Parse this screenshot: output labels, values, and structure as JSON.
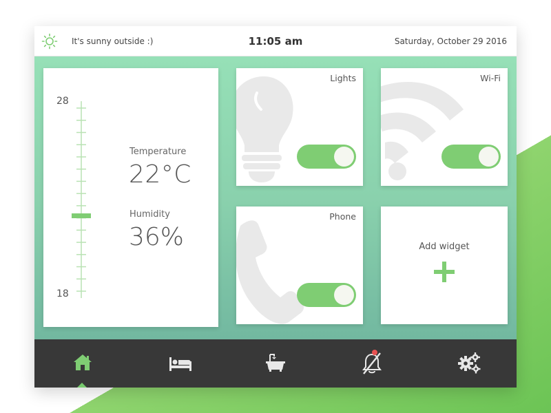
{
  "header": {
    "weather_icon": "sun-icon",
    "weather_text": "It's sunny outside :)",
    "time": "11:05 am",
    "date": "Saturday, October 29 2016"
  },
  "climate": {
    "scale_max": "28",
    "scale_min": "18",
    "slider_level": 0.5,
    "temperature_label": "Temperature",
    "temperature_value": "22°C",
    "humidity_label": "Humidity",
    "humidity_value": "36%"
  },
  "widgets": {
    "lights": {
      "label": "Lights",
      "icon": "lightbulb-icon",
      "on": true
    },
    "wifi": {
      "label": "Wi-Fi",
      "icon": "wifi-icon",
      "on": true
    },
    "phone": {
      "label": "Phone",
      "icon": "phone-icon",
      "on": true
    },
    "add": {
      "label": "Add widget",
      "icon": "plus-icon"
    }
  },
  "nav": {
    "items": [
      {
        "icon": "home-icon",
        "active": true
      },
      {
        "icon": "bed-icon",
        "active": false
      },
      {
        "icon": "bathtub-icon",
        "active": false
      },
      {
        "icon": "muted-bell-icon",
        "active": false,
        "notification": true
      },
      {
        "icon": "settings-gears-icon",
        "active": false
      }
    ]
  },
  "colors": {
    "accent": "#7fcd73",
    "nav_background": "#383838",
    "notification": "#e85252"
  }
}
